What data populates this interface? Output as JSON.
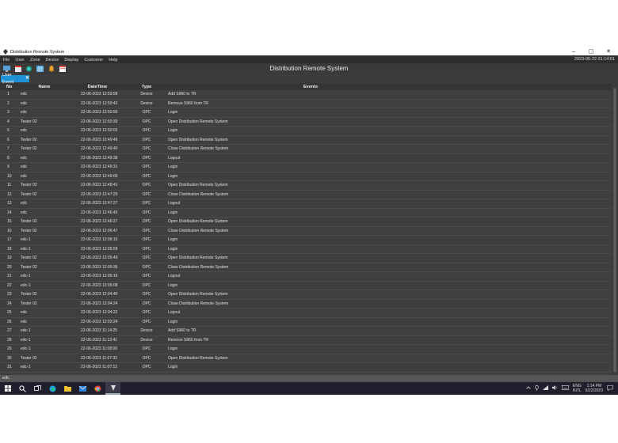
{
  "window": {
    "title": "Distribution Remote System",
    "controls": [
      "–",
      "▢",
      "✕"
    ]
  },
  "menu": {
    "items": [
      "File",
      "User",
      "Zone",
      "Device",
      "Display",
      "Customer",
      "Help"
    ],
    "clock": "2023-06-22 01:14:51"
  },
  "toolbar": {
    "heading": "Distribution Remote System",
    "icons": [
      "monitor-icon",
      "calendar-icon",
      "map-icon",
      "table-icon",
      "bell-icon",
      "report-icon"
    ]
  },
  "tab": {
    "label": "User Event",
    "close": "✕"
  },
  "table": {
    "columns": [
      "No",
      "Name",
      "DateTime",
      "Type",
      "Events"
    ],
    "rows": [
      [
        "1",
        "edc",
        "22-06-2023 12:59:58",
        "Device",
        "Add S960 to TR"
      ],
      [
        "2",
        "edc",
        "22-06-2023 12:59:42",
        "Device",
        "Remove S960 from TR"
      ],
      [
        "3",
        "edc",
        "22-06-2023 12:50:50",
        "OPC",
        "Login"
      ],
      [
        "4",
        "Tester 02",
        "22-06-2023 12:50:39",
        "OPC",
        "Open Distribution Remote System"
      ],
      [
        "5",
        "edc",
        "22-06-2023 12:50:02",
        "OPC",
        "Login"
      ],
      [
        "6",
        "Tester 02",
        "22-06-2023 12:49:49",
        "OPC",
        "Open Distribution Remote System"
      ],
      [
        "7",
        "Tester 02",
        "22-06-2023 12:49:40",
        "OPC",
        "Close Distribution Remote System"
      ],
      [
        "8",
        "edc",
        "22-06-2023 12:49:38",
        "OPC",
        "Logout"
      ],
      [
        "9",
        "edc",
        "22-06-2023 12:49:31",
        "OPC",
        "Login"
      ],
      [
        "10",
        "edc",
        "22-06-2023 12:49:00",
        "OPC",
        "Login"
      ],
      [
        "11",
        "Tester 02",
        "22-06-2023 12:48:41",
        "OPC",
        "Open Distribution Remote System"
      ],
      [
        "12",
        "Tester 02",
        "22-06-2023 12:47:29",
        "OPC",
        "Close Distribution Remote System"
      ],
      [
        "13",
        "edc",
        "22-06-2023 12:47:27",
        "OPC",
        "Logout"
      ],
      [
        "14",
        "edc",
        "22-06-2023 12:46:45",
        "OPC",
        "Login"
      ],
      [
        "15",
        "Tester 02",
        "22-06-2023 12:46:27",
        "OPC",
        "Open Distribution Remote System"
      ],
      [
        "16",
        "Tester 02",
        "22-06-2023 12:06:47",
        "OPC",
        "Close Distribution Remote System"
      ],
      [
        "17",
        "edc-1",
        "22-06-2023 12:06:15",
        "OPC",
        "Login"
      ],
      [
        "18",
        "edc-1",
        "22-06-2023 12:05:59",
        "OPC",
        "Login"
      ],
      [
        "19",
        "Tester 02",
        "22-06-2023 12:05:49",
        "OPC",
        "Open Distribution Remote System"
      ],
      [
        "20",
        "Tester 02",
        "22-06-2023 12:05:36",
        "OPC",
        "Close Distribution Remote System"
      ],
      [
        "21",
        "edc-1",
        "22-06-2023 12:05:16",
        "OPC",
        "Logout"
      ],
      [
        "22",
        "edc-1",
        "22-06-2023 12:05:08",
        "OPC",
        "Login"
      ],
      [
        "23",
        "Tester 02",
        "22-06-2023 12:04:40",
        "OPC",
        "Open Distribution Remote System"
      ],
      [
        "24",
        "Tester 02",
        "22-06-2023 12:04:24",
        "OPC",
        "Close Distribution Remote System"
      ],
      [
        "25",
        "edc",
        "22-06-2023 12:04:22",
        "OPC",
        "Logout"
      ],
      [
        "26",
        "edc",
        "22-06-2023 12:03:24",
        "OPC",
        "Login"
      ],
      [
        "27",
        "edc-1",
        "22-06-2023 11:14:25",
        "Device",
        "Add S960 to TR"
      ],
      [
        "28",
        "edc-1",
        "22-06-2023 11:13:41",
        "Device",
        "Remove S960 from TR"
      ],
      [
        "29",
        "edc-1",
        "22-06-2023 11:08:00",
        "OPC",
        "Login"
      ],
      [
        "30",
        "Tester 02",
        "22-06-2023 11:07:32",
        "OPC",
        "Open Distribution Remote System"
      ],
      [
        "31",
        "edc-1",
        "22-06-2023 11:07:12",
        "OPC",
        "Login"
      ]
    ]
  },
  "status": {
    "text": "edc"
  },
  "taskbar": {
    "icons": [
      "windows-start-icon",
      "search-icon",
      "task-view-icon",
      "edge-browser-icon",
      "file-explorer-icon",
      "mail-icon",
      "chrome-icon",
      "app-icon"
    ],
    "tray_icons": [
      "chevron-up-icon",
      "location-icon",
      "network-icon",
      "volume-icon",
      "keyboard-icon"
    ],
    "lang_top": "ENG",
    "lang_bottom": "INTL",
    "time": "1:14 PM",
    "date": "6/22/2023",
    "notifications_icon": "notification-icon"
  },
  "colors": {
    "window_bg": "#3c3c3c",
    "menubar_bg": "#2d2d2d",
    "tab_accent": "#1e90d6",
    "taskbar_bg": "#1f1f2e"
  }
}
